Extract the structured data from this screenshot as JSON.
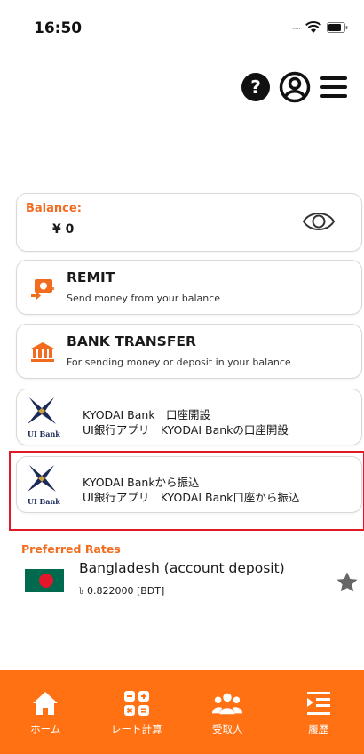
{
  "status_bar": {
    "time": "16:50",
    "signal": "....."
  },
  "header": {
    "icons": [
      "help-icon",
      "profile-icon",
      "menu-icon"
    ]
  },
  "balance": {
    "label": "Balance:",
    "value": "¥ 0",
    "toggle_icon": "eye-icon"
  },
  "actions": [
    {
      "title": "REMIT",
      "subtitle": "Send money from your balance",
      "icon": "remit-icon"
    },
    {
      "title": "BANK TRANSFER",
      "subtitle": "For sending money or deposit in your balance",
      "icon": "bank-icon"
    }
  ],
  "ui_bank": {
    "logo_text": "UI Bank",
    "items": [
      {
        "line1": "KYODAI Bank　口座開設",
        "line2": "UI銀行アプリ　KYODAI Bankの口座開設"
      },
      {
        "line1": "KYODAI Bankから振込",
        "line2": "UI銀行アプリ　KYODAI Bank口座から振込"
      }
    ]
  },
  "preferred_rates": {
    "title": "Preferred Rates",
    "items": [
      {
        "name": "Bangladesh (account deposit)",
        "rate": "৳ 0.822000 [BDT]",
        "flag": "bangladesh-flag",
        "favorite_icon": "star-icon"
      }
    ]
  },
  "tab_bar": {
    "tabs": [
      {
        "label": "ホーム",
        "icon": "home-icon"
      },
      {
        "label": "レート計算",
        "icon": "calculator-icon"
      },
      {
        "label": "受取人",
        "icon": "recipients-icon"
      },
      {
        "label": "履歴",
        "icon": "history-icon"
      }
    ]
  },
  "colors": {
    "accent": "#f26c1f",
    "tab_bar": "#ff7112",
    "highlight": "#e01a24"
  }
}
